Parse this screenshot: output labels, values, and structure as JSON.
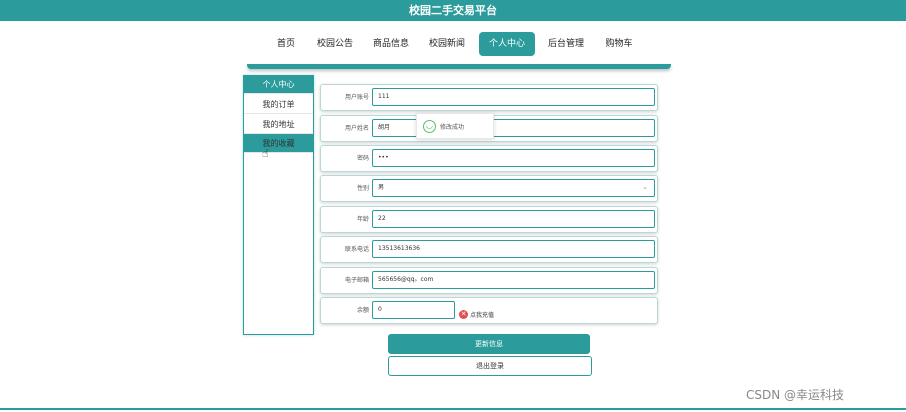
{
  "app": {
    "title": "校园二手交易平台"
  },
  "nav": {
    "items": [
      "首页",
      "校园公告",
      "商品信息",
      "校园新闻",
      "个人中心",
      "后台管理",
      "购物车"
    ],
    "active": "个人中心"
  },
  "sidebar": {
    "items": [
      "个人中心",
      "我的订单",
      "我的地址",
      "我的收藏"
    ],
    "active": "个人中心",
    "hovered": "我的收藏"
  },
  "form": {
    "account": {
      "label": "用户账号",
      "value": "111"
    },
    "name": {
      "label": "用户姓名",
      "value": "胡月"
    },
    "password": {
      "label": "密码",
      "value": "•••"
    },
    "gender": {
      "label": "性别",
      "value": "男",
      "icon": "chevron-down-icon"
    },
    "age": {
      "label": "年龄",
      "value": "22"
    },
    "phone": {
      "label": "联系电话",
      "value": "13513613636"
    },
    "email": {
      "label": "电子邮箱",
      "value": "565656@qq。com"
    },
    "balance": {
      "label": "余额",
      "value": "0",
      "recharge_label": "点我充值"
    }
  },
  "toast": {
    "message": "修改成功",
    "icon": "smile-icon"
  },
  "buttons": {
    "update": "更新信息",
    "logout": "退出登录"
  },
  "watermark": "CSDN @幸运科技",
  "colors": {
    "accent": "#2b9b9b",
    "success": "#57c06a",
    "danger": "#e14c4c"
  }
}
